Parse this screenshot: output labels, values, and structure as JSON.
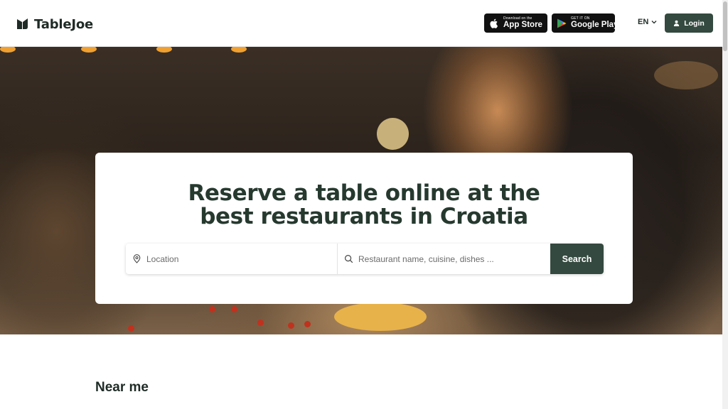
{
  "brand": {
    "name": "TableJoe"
  },
  "header": {
    "app_store": {
      "small": "Download on the",
      "big": "App Store"
    },
    "google_play": {
      "small": "GET IT ON",
      "big": "Google Play"
    },
    "language": "EN",
    "login_label": "Login"
  },
  "hero": {
    "headline_line1": "Reserve a table online at the",
    "headline_line2": "best restaurants in Croatia",
    "location_placeholder": "Location",
    "query_placeholder": "Restaurant name, cuisine, dishes ...",
    "search_label": "Search"
  },
  "sections": {
    "near_me": "Near me"
  },
  "icons": {
    "logo": "tablejoe-logo-icon",
    "apple": "apple-icon",
    "google_play": "google-play-icon",
    "chevron": "chevron-down-icon",
    "user": "user-icon",
    "location": "location-pin-icon",
    "search": "search-icon"
  },
  "colors": {
    "brand_dark_green": "#34493f",
    "headline": "#26392f"
  }
}
